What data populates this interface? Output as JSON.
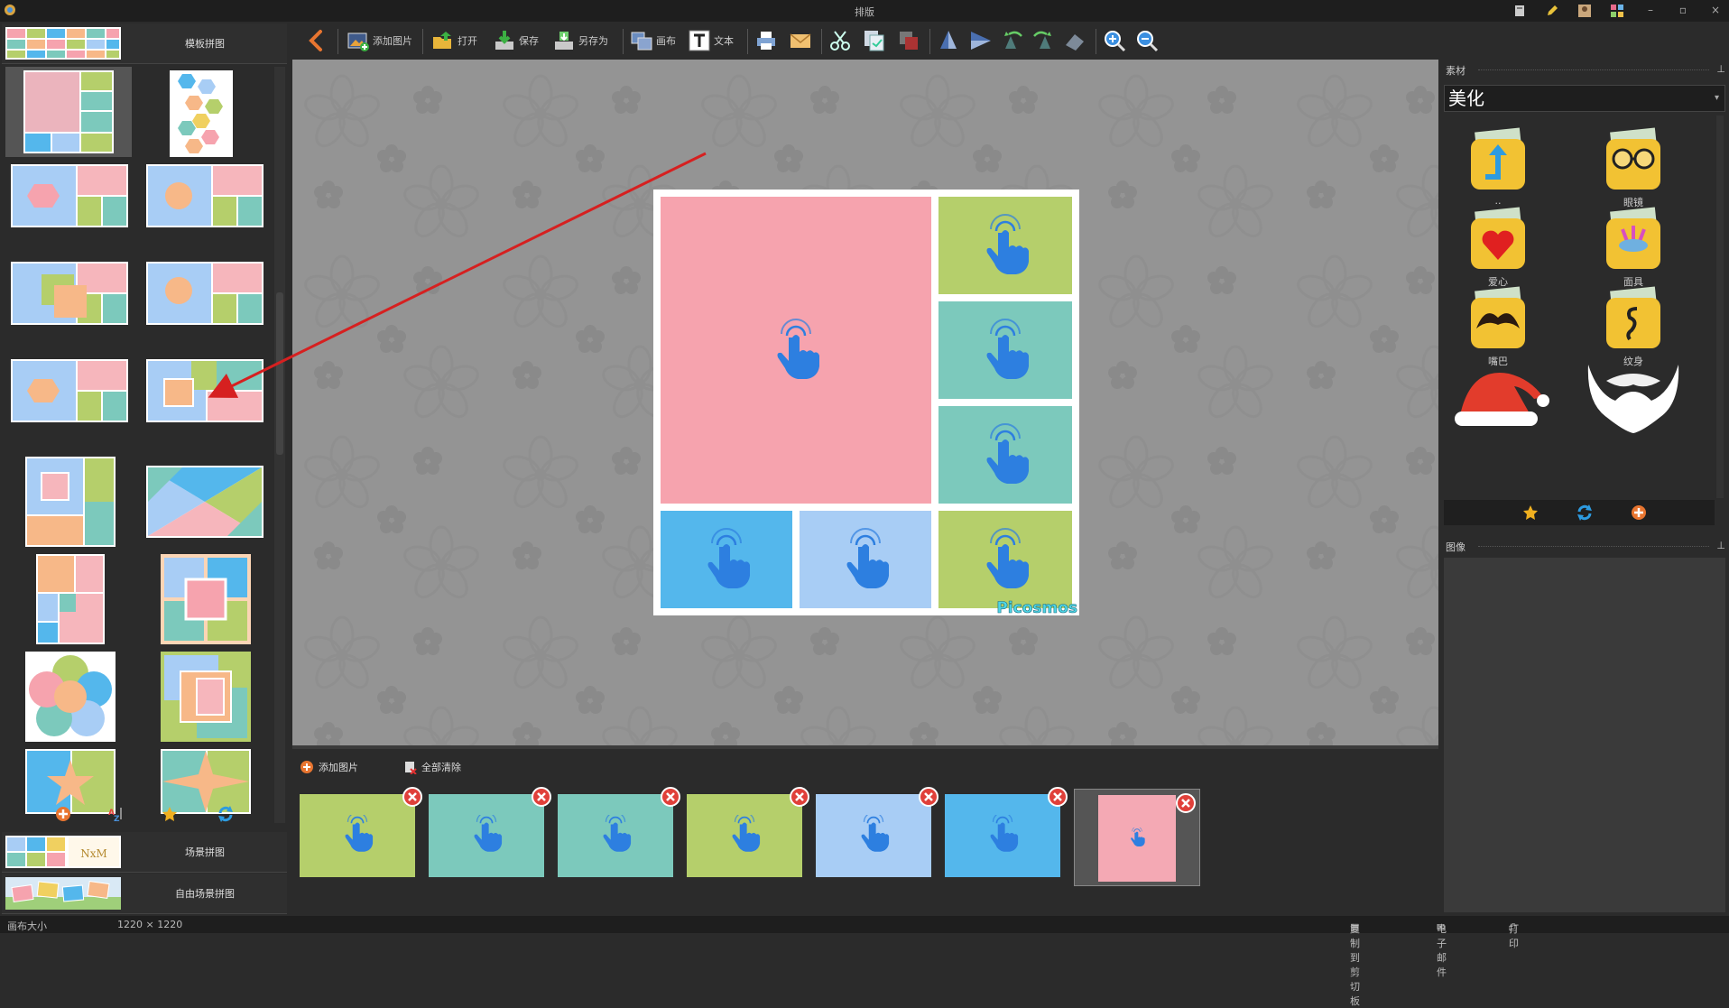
{
  "window": {
    "title": "排版"
  },
  "toolbar": {
    "add_image": "添加图片",
    "open": "打开",
    "save": "保存",
    "save_as": "另存为",
    "canvas": "画布",
    "text": "文本"
  },
  "left_panel": {
    "template_collage": "模板拼图",
    "scene_collage": "场景拼图",
    "free_scene_collage": "自由场景拼图",
    "scene_thumb_text": "NxM"
  },
  "canvas": {
    "watermark": "Picosmos"
  },
  "bottom_strip": {
    "add_image": "添加图片",
    "clear_all": "全部清除",
    "thumbs": [
      {
        "color": "#b5cf6b"
      },
      {
        "color": "#7cc9bc"
      },
      {
        "color": "#7cc9bc"
      },
      {
        "color": "#b5cf6b"
      },
      {
        "color": "#a8cdf5"
      },
      {
        "color": "#54b7ec"
      },
      {
        "color": "#f4a9b4"
      }
    ]
  },
  "right_panel": {
    "materials_title": "素材",
    "category": "美化",
    "items": [
      {
        "label": "..",
        "icon": "up-folder-icon"
      },
      {
        "label": "眼镜",
        "icon": "glasses-folder-icon"
      },
      {
        "label": "爱心",
        "icon": "heart-folder-icon"
      },
      {
        "label": "面具",
        "icon": "mask-folder-icon"
      },
      {
        "label": "嘴巴",
        "icon": "mustache-folder-icon"
      },
      {
        "label": "纹身",
        "icon": "tattoo-folder-icon"
      },
      {
        "label": "",
        "icon": "santa-hat-icon"
      },
      {
        "label": "",
        "icon": "beard-icon"
      }
    ],
    "image_title": "图像"
  },
  "statusbar": {
    "canvas_size_label": "画布大小",
    "canvas_size_value": "1220 × 1220",
    "copy_clipboard": "复制到剪切板",
    "email": "电子邮件",
    "print": "打印"
  },
  "colors": {
    "pink": "#f6a3ae",
    "green": "#b5cf6b",
    "teal": "#7cc9bc",
    "blue": "#54b7ec",
    "light_blue": "#a8cdf5",
    "orange": "#f7b888",
    "accent_orange": "#e87530",
    "hand_blue": "#2d7fe0"
  }
}
